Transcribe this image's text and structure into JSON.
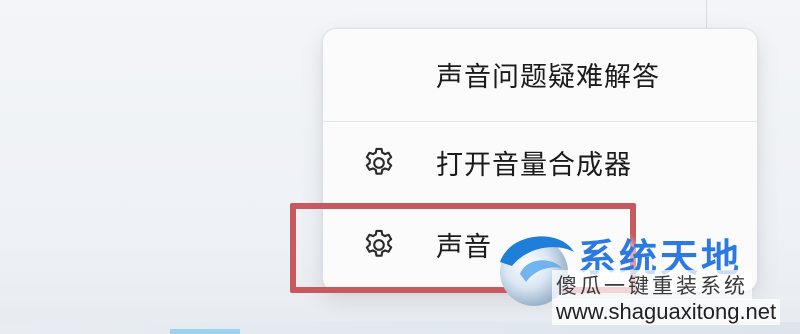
{
  "context_menu": {
    "items": [
      {
        "label": "声音问题疑难解答",
        "icon": null
      },
      {
        "label": "打开音量合成器",
        "icon": "gear-icon"
      },
      {
        "label": "声音",
        "icon": "gear-icon"
      }
    ]
  },
  "watermark": {
    "title": "系统天地",
    "subtitle": "傻瓜一键重装系统",
    "url": "www.shaguaxitong.net"
  },
  "colors": {
    "highlight_border": "#c85a5f",
    "watermark_blue": "#2c79e1",
    "menu_background": "#fbfbfc"
  }
}
